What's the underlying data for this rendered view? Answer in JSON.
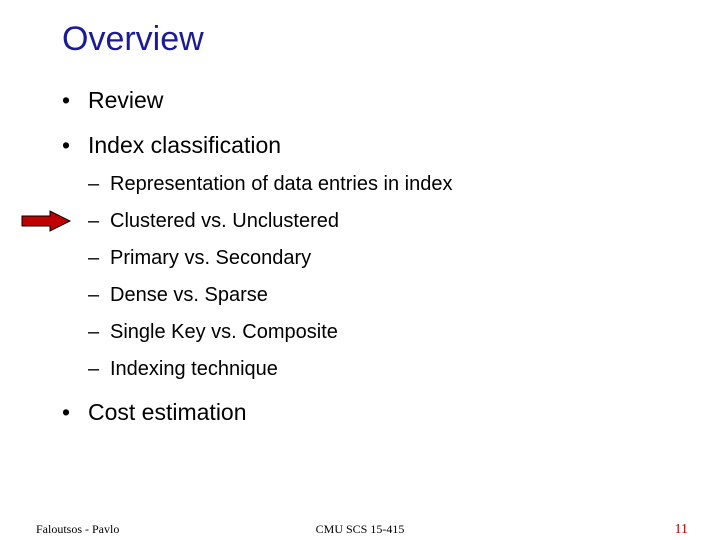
{
  "title": "Overview",
  "bullets": {
    "b0": "Review",
    "b1": "Index classification",
    "b2": "Cost estimation"
  },
  "sub": {
    "s0": "Representation of data entries in index",
    "s1": "Clustered vs. Unclustered",
    "s2": "Primary vs. Secondary",
    "s3": "Dense vs. Sparse",
    "s4": "Single Key vs. Composite",
    "s5": "Indexing technique"
  },
  "footer": {
    "left": "Faloutsos - Pavlo",
    "center": "CMU SCS 15-415",
    "right": "11"
  }
}
